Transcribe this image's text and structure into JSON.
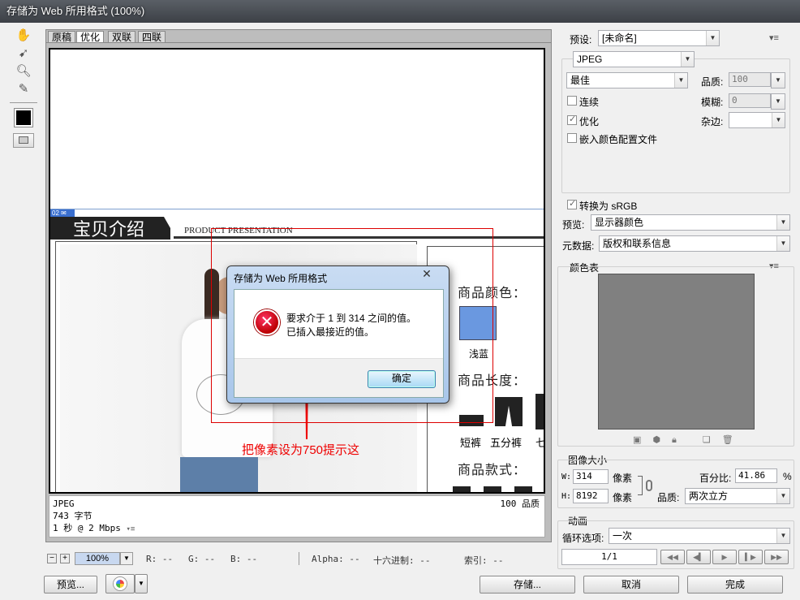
{
  "window": {
    "title": "存储为 Web 所用格式 (100%)"
  },
  "view_tabs": [
    "原稿",
    "优化",
    "双联",
    "四联"
  ],
  "preview": {
    "section_number": "02",
    "section_title": "宝贝介绍",
    "section_subtitle": "PRODUCT PRESENTATION",
    "color_heading": "商品颜色：",
    "color_name": "浅蓝",
    "color_value": "#6a98e0",
    "length_heading": "商品长度：",
    "length_labels": [
      "短裤",
      "五分裤",
      "七"
    ],
    "style_heading": "商品款式：",
    "annotation": "把像素设为750提示这"
  },
  "info": {
    "format": "JPEG",
    "size": "743 字节",
    "speed": "1 秒 @ 2 Mbps",
    "quality": "100 品质"
  },
  "status": {
    "zoom": "100%",
    "r": "R: --",
    "g": "G: --",
    "b": "B: --",
    "alpha": "Alpha: --",
    "hex": "十六进制: --",
    "index": "索引: --"
  },
  "buttons": {
    "preview": "预览...",
    "save": "存储...",
    "cancel": "取消",
    "done": "完成"
  },
  "settings": {
    "preset_label": "预设:",
    "preset_value": "[未命名]",
    "format_value": "JPEG",
    "compression_value": "最佳",
    "quality_label": "品质:",
    "quality_value": "100",
    "progressive_label": "连续",
    "blur_label": "模糊:",
    "blur_value": "0",
    "optimized_label": "优化",
    "matte_label": "杂边:",
    "embed_profile_label": "嵌入颜色配置文件",
    "convert_srgb_label": "转换为 sRGB",
    "preview_label": "预览:",
    "preview_value": "显示器颜色",
    "metadata_label": "元数据:",
    "metadata_value": "版权和联系信息"
  },
  "color_table": {
    "label": "颜色表"
  },
  "image_size": {
    "label": "图像大小",
    "w_label": "W:",
    "w_value": "314",
    "h_label": "H:",
    "h_value": "8192",
    "unit": "像素",
    "percent_label": "百分比:",
    "percent_value": "41.86",
    "percent_unit": "%",
    "quality_label": "品质:",
    "quality_value": "两次立方"
  },
  "animation": {
    "label": "动画",
    "loop_label": "循环选项:",
    "loop_value": "一次",
    "frame": "1/1"
  },
  "dialog": {
    "title": "存储为 Web 所用格式",
    "line1": "要求介于 1 到 314 之间的值。",
    "line2": "已插入最接近的值。",
    "ok": "确定"
  }
}
